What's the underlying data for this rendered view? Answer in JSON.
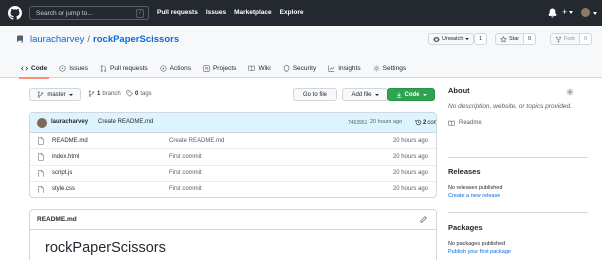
{
  "topbar": {
    "search_placeholder": "Search or jump to...",
    "search_shortcut": "/",
    "nav": [
      "Pull requests",
      "Issues",
      "Marketplace",
      "Explore"
    ],
    "new_label": "+"
  },
  "repo": {
    "owner": "lauracharvey",
    "separator": "/",
    "name": "rockPaperScissors",
    "unwatch_label": "Unwatch",
    "watch_count": "1",
    "star_label": "Star",
    "star_count": "0",
    "fork_label": "Fork",
    "fork_count": "0"
  },
  "tabs": [
    {
      "label": "Code",
      "icon": "code-icon",
      "active": true
    },
    {
      "label": "Issues",
      "icon": "issue-icon"
    },
    {
      "label": "Pull requests",
      "icon": "pull-request-icon"
    },
    {
      "label": "Actions",
      "icon": "play-icon"
    },
    {
      "label": "Projects",
      "icon": "project-icon"
    },
    {
      "label": "Wiki",
      "icon": "book-icon"
    },
    {
      "label": "Security",
      "icon": "shield-icon"
    },
    {
      "label": "Insights",
      "icon": "graph-icon"
    },
    {
      "label": "Settings",
      "icon": "gear-icon"
    }
  ],
  "branchbar": {
    "branch": "master",
    "branches_count": "1",
    "branches_label": "branch",
    "tags_count": "0",
    "tags_label": "tags",
    "goto_file": "Go to file",
    "add_file": "Add file",
    "code": "Code"
  },
  "latest_commit": {
    "author": "lauracharvey",
    "message": "Create README.md",
    "sha": "7463951",
    "time": "20 hours ago",
    "commits_count": "2",
    "commits_label": "commits"
  },
  "files": [
    {
      "name": "README.md",
      "message": "Create README.md",
      "age": "20 hours ago"
    },
    {
      "name": "index.html",
      "message": "First commit",
      "age": "20 hours ago"
    },
    {
      "name": "script.js",
      "message": "First commit",
      "age": "20 hours ago"
    },
    {
      "name": "style.css",
      "message": "First commit",
      "age": "20 hours ago"
    }
  ],
  "readme": {
    "filename": "README.md",
    "heading": "rockPaperScissors"
  },
  "sidebar": {
    "about_title": "About",
    "about_text": "No description, website, or topics provided.",
    "readme_label": "Readme",
    "releases_title": "Releases",
    "releases_text": "No releases published",
    "releases_link": "Create a new release",
    "packages_title": "Packages",
    "packages_text": "No packages published",
    "packages_link": "Publish your first package"
  },
  "colors": {
    "header_bg": "#24292f",
    "accent_link": "#0969da",
    "code_button": "#2da44e",
    "active_tab_underline": "#fd8c73",
    "commit_row_bg": "#ddf4ff"
  }
}
